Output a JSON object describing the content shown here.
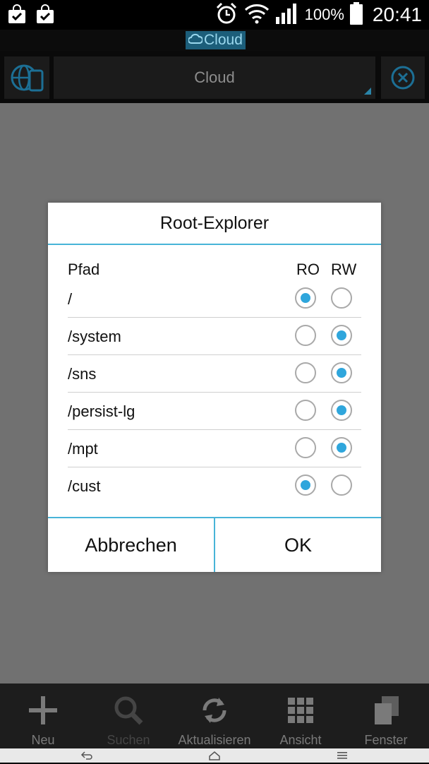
{
  "status_bar": {
    "battery_percent": "100%",
    "time": "20:41",
    "icons": [
      "shopping-bag-check-icon",
      "shopping-bag-check-icon",
      "alarm-clock-icon",
      "wifi-icon",
      "signal-icon",
      "battery-icon"
    ]
  },
  "app": {
    "title_tag": "Cloud"
  },
  "toolbar": {
    "location_label": "Cloud",
    "left_icon": "globe-device-icon",
    "right_icon": "close-circle-icon"
  },
  "dialog": {
    "title": "Root-Explorer",
    "header": {
      "path": "Pfad",
      "ro": "RO",
      "rw": "RW"
    },
    "rows": [
      {
        "path": "/",
        "mode": "RO"
      },
      {
        "path": "/system",
        "mode": "RW"
      },
      {
        "path": "/sns",
        "mode": "RW"
      },
      {
        "path": "/persist-lg",
        "mode": "RW"
      },
      {
        "path": "/mpt",
        "mode": "RW"
      },
      {
        "path": "/cust",
        "mode": "RO"
      }
    ],
    "cancel_label": "Abbrechen",
    "ok_label": "OK"
  },
  "bottom_bar": {
    "items": [
      {
        "label": "Neu",
        "icon": "plus-icon",
        "enabled": true
      },
      {
        "label": "Suchen",
        "icon": "search-icon",
        "enabled": false
      },
      {
        "label": "Aktualisieren",
        "icon": "refresh-icon",
        "enabled": true
      },
      {
        "label": "Ansicht",
        "icon": "grid-icon",
        "enabled": true
      },
      {
        "label": "Fenster",
        "icon": "windows-icon",
        "enabled": true
      }
    ]
  },
  "nav_bar": {
    "icons": [
      "back-icon",
      "home-icon",
      "menu-icon"
    ]
  },
  "colors": {
    "accent": "#2fa6dc",
    "divider": "#48b4d8",
    "overlay": "#717171"
  }
}
